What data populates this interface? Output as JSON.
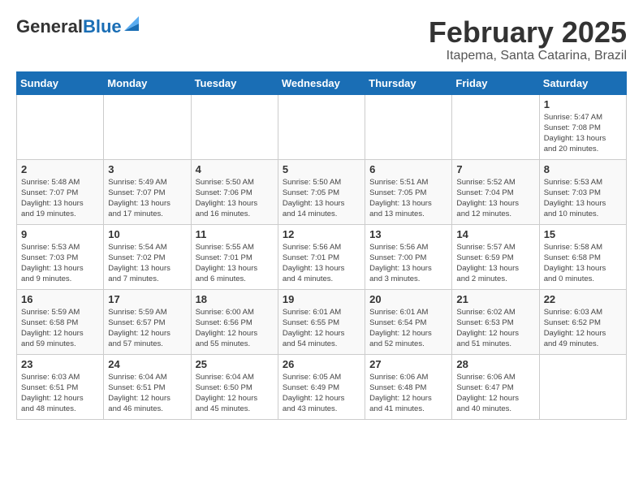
{
  "header": {
    "logo_general": "General",
    "logo_blue": "Blue",
    "month_title": "February 2025",
    "location": "Itapema, Santa Catarina, Brazil"
  },
  "weekdays": [
    "Sunday",
    "Monday",
    "Tuesday",
    "Wednesday",
    "Thursday",
    "Friday",
    "Saturday"
  ],
  "weeks": [
    [
      {
        "day": "",
        "info": ""
      },
      {
        "day": "",
        "info": ""
      },
      {
        "day": "",
        "info": ""
      },
      {
        "day": "",
        "info": ""
      },
      {
        "day": "",
        "info": ""
      },
      {
        "day": "",
        "info": ""
      },
      {
        "day": "1",
        "info": "Sunrise: 5:47 AM\nSunset: 7:08 PM\nDaylight: 13 hours\nand 20 minutes."
      }
    ],
    [
      {
        "day": "2",
        "info": "Sunrise: 5:48 AM\nSunset: 7:07 PM\nDaylight: 13 hours\nand 19 minutes."
      },
      {
        "day": "3",
        "info": "Sunrise: 5:49 AM\nSunset: 7:07 PM\nDaylight: 13 hours\nand 17 minutes."
      },
      {
        "day": "4",
        "info": "Sunrise: 5:50 AM\nSunset: 7:06 PM\nDaylight: 13 hours\nand 16 minutes."
      },
      {
        "day": "5",
        "info": "Sunrise: 5:50 AM\nSunset: 7:05 PM\nDaylight: 13 hours\nand 14 minutes."
      },
      {
        "day": "6",
        "info": "Sunrise: 5:51 AM\nSunset: 7:05 PM\nDaylight: 13 hours\nand 13 minutes."
      },
      {
        "day": "7",
        "info": "Sunrise: 5:52 AM\nSunset: 7:04 PM\nDaylight: 13 hours\nand 12 minutes."
      },
      {
        "day": "8",
        "info": "Sunrise: 5:53 AM\nSunset: 7:03 PM\nDaylight: 13 hours\nand 10 minutes."
      }
    ],
    [
      {
        "day": "9",
        "info": "Sunrise: 5:53 AM\nSunset: 7:03 PM\nDaylight: 13 hours\nand 9 minutes."
      },
      {
        "day": "10",
        "info": "Sunrise: 5:54 AM\nSunset: 7:02 PM\nDaylight: 13 hours\nand 7 minutes."
      },
      {
        "day": "11",
        "info": "Sunrise: 5:55 AM\nSunset: 7:01 PM\nDaylight: 13 hours\nand 6 minutes."
      },
      {
        "day": "12",
        "info": "Sunrise: 5:56 AM\nSunset: 7:01 PM\nDaylight: 13 hours\nand 4 minutes."
      },
      {
        "day": "13",
        "info": "Sunrise: 5:56 AM\nSunset: 7:00 PM\nDaylight: 13 hours\nand 3 minutes."
      },
      {
        "day": "14",
        "info": "Sunrise: 5:57 AM\nSunset: 6:59 PM\nDaylight: 13 hours\nand 2 minutes."
      },
      {
        "day": "15",
        "info": "Sunrise: 5:58 AM\nSunset: 6:58 PM\nDaylight: 13 hours\nand 0 minutes."
      }
    ],
    [
      {
        "day": "16",
        "info": "Sunrise: 5:59 AM\nSunset: 6:58 PM\nDaylight: 12 hours\nand 59 minutes."
      },
      {
        "day": "17",
        "info": "Sunrise: 5:59 AM\nSunset: 6:57 PM\nDaylight: 12 hours\nand 57 minutes."
      },
      {
        "day": "18",
        "info": "Sunrise: 6:00 AM\nSunset: 6:56 PM\nDaylight: 12 hours\nand 55 minutes."
      },
      {
        "day": "19",
        "info": "Sunrise: 6:01 AM\nSunset: 6:55 PM\nDaylight: 12 hours\nand 54 minutes."
      },
      {
        "day": "20",
        "info": "Sunrise: 6:01 AM\nSunset: 6:54 PM\nDaylight: 12 hours\nand 52 minutes."
      },
      {
        "day": "21",
        "info": "Sunrise: 6:02 AM\nSunset: 6:53 PM\nDaylight: 12 hours\nand 51 minutes."
      },
      {
        "day": "22",
        "info": "Sunrise: 6:03 AM\nSunset: 6:52 PM\nDaylight: 12 hours\nand 49 minutes."
      }
    ],
    [
      {
        "day": "23",
        "info": "Sunrise: 6:03 AM\nSunset: 6:51 PM\nDaylight: 12 hours\nand 48 minutes."
      },
      {
        "day": "24",
        "info": "Sunrise: 6:04 AM\nSunset: 6:51 PM\nDaylight: 12 hours\nand 46 minutes."
      },
      {
        "day": "25",
        "info": "Sunrise: 6:04 AM\nSunset: 6:50 PM\nDaylight: 12 hours\nand 45 minutes."
      },
      {
        "day": "26",
        "info": "Sunrise: 6:05 AM\nSunset: 6:49 PM\nDaylight: 12 hours\nand 43 minutes."
      },
      {
        "day": "27",
        "info": "Sunrise: 6:06 AM\nSunset: 6:48 PM\nDaylight: 12 hours\nand 41 minutes."
      },
      {
        "day": "28",
        "info": "Sunrise: 6:06 AM\nSunset: 6:47 PM\nDaylight: 12 hours\nand 40 minutes."
      },
      {
        "day": "",
        "info": ""
      }
    ]
  ]
}
